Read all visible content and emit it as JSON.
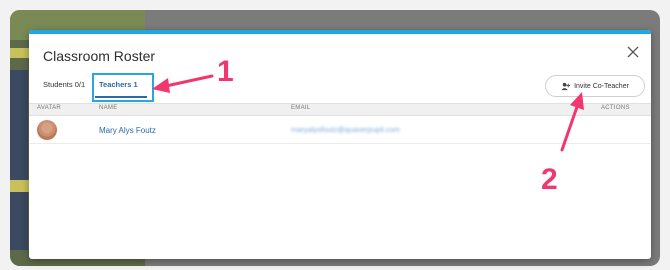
{
  "modal": {
    "title": "Classroom Roster",
    "tabs": [
      {
        "label": "Students 0/1"
      },
      {
        "label": "Teachers 1"
      }
    ],
    "invite_button_label": "Invite Co-Teacher",
    "columns": [
      "AVATAR",
      "NAME",
      "EMAIL",
      "ACTIONS"
    ],
    "rows": [
      {
        "name": "Mary Alys Foutz",
        "email": "maryalysfoutz@quaverpupil.com"
      }
    ]
  },
  "annotations": {
    "marker_1": "1",
    "marker_2": "2",
    "color": "#f0386e"
  },
  "icons": [
    "close-icon",
    "person-add-icon",
    "arrow-icon"
  ],
  "colors": {
    "accent": "#1fa7e0",
    "link": "#2a6aa5"
  }
}
